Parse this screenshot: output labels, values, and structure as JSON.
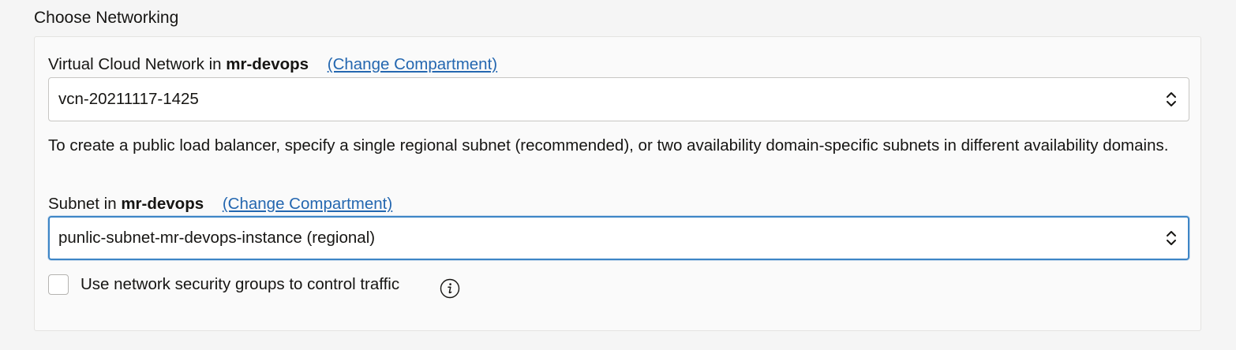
{
  "section": {
    "title": "Choose Networking"
  },
  "vcn": {
    "label_prefix": "Virtual Cloud Network in",
    "compartment": "mr-devops",
    "change_link": "(Change Compartment)",
    "selected_value": "vcn-20211117-1425",
    "icon": "chevron-up-down-icon"
  },
  "help": {
    "text": "To create a public load balancer, specify a single regional subnet (recommended), or two availability domain-specific subnets in different availability domains."
  },
  "subnet": {
    "label_prefix": "Subnet in",
    "compartment": "mr-devops",
    "change_link": "(Change Compartment)",
    "selected_value": "punlic-subnet-mr-devops-instance (regional)",
    "icon": "chevron-up-down-icon"
  },
  "nsg": {
    "checkbox_label": "Use network security groups to control traffic",
    "checked": false,
    "info_icon": "info-icon"
  },
  "colors": {
    "link": "#2467b0",
    "focus_border": "#3d85c6",
    "text": "#161513",
    "background": "#f5f5f5",
    "panel": "#fafafa"
  }
}
